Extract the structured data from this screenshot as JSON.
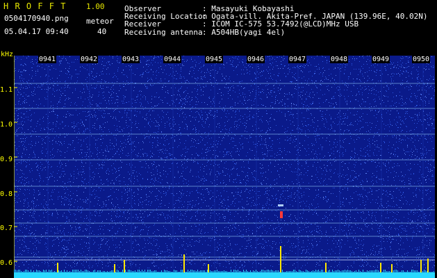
{
  "header": {
    "app_name": "H R O F F T",
    "version": "1.00",
    "filename": "0504170940.png",
    "timestamp": "05.04.17 09:40",
    "counter_label": "meteor",
    "counter_value": "40"
  },
  "info": {
    "rows": [
      {
        "label": "Observer",
        "value": ": Masayuki Kobayashi"
      },
      {
        "label": "Receiving Location",
        "value": ": Ogata-vill. Akita-Pref. JAPAN (139.96E, 40.02N)"
      },
      {
        "label": "Receiver",
        "value": ": ICOM IC-575 53.7492(@LCD)MHz USB"
      },
      {
        "label": "Receiving antenna",
        "value": ": A504HB(yagi 4el)"
      }
    ]
  },
  "spectrogram": {
    "y_unit": "kHz",
    "y_ticks": [
      "1.1",
      "1.0",
      "0.9",
      "0.8",
      "0.7",
      "0.6"
    ],
    "x_ticks": [
      "0941",
      "0942",
      "0943",
      "0944",
      "0945",
      "0946",
      "0947",
      "0948",
      "0949",
      "0950"
    ],
    "colors": {
      "background": "#0a1a8a",
      "noise": "#3a6cff",
      "line": "#9ad8ff",
      "axis": "#ffff00",
      "bars": "#ffe800",
      "baseline": "#29d8ff"
    }
  }
}
